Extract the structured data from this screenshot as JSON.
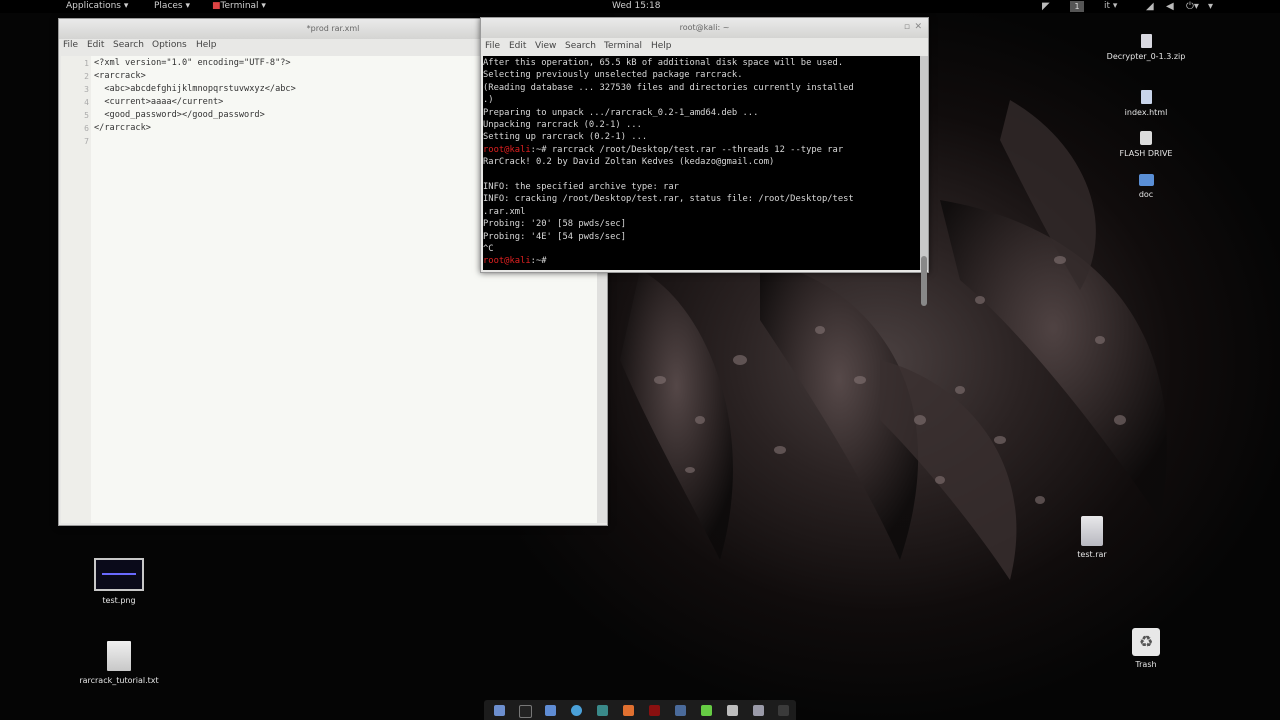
{
  "topbar": {
    "applications": "Applications ▾",
    "places": "Places ▾",
    "terminal_menu": "Terminal ▾",
    "clock": "Wed 15:18",
    "lang_box": "1",
    "lang": "it ▾"
  },
  "gedit": {
    "title": "*prod rar.xml",
    "menu": [
      "File",
      "Edit",
      "Search",
      "Options",
      "Help"
    ],
    "line_numbers": [
      "1",
      "2",
      "3",
      "4",
      "5",
      "6",
      "7"
    ],
    "lines": [
      "<?xml version=\"1.0\" encoding=\"UTF-8\"?>",
      "<rarcrack>",
      "  <abc>abcdefghijklmnopqrstuvwxyz</abc>",
      "  <current>aaaa</current>",
      "  <good_password></good_password>",
      "</rarcrack>",
      ""
    ]
  },
  "terminal": {
    "title": "root@kali: ~",
    "menu": [
      "File",
      "Edit",
      "View",
      "Search",
      "Terminal",
      "Help"
    ],
    "lines": [
      {
        "prompt": "",
        "text": "After this operation, 65.5 kB of additional disk space will be used."
      },
      {
        "prompt": "",
        "text": "Selecting previously unselected package rarcrack."
      },
      {
        "prompt": "",
        "text": "(Reading database ... 327530 files and directories currently installed"
      },
      {
        "prompt": "",
        "text": ".)"
      },
      {
        "prompt": "",
        "text": "Preparing to unpack .../rarcrack_0.2-1_amd64.deb ..."
      },
      {
        "prompt": "",
        "text": "Unpacking rarcrack (0.2-1) ..."
      },
      {
        "prompt": "",
        "text": "Setting up rarcrack (0.2-1) ..."
      },
      {
        "prompt": "root@kali",
        "text": ":~# rarcrack /root/Desktop/test.rar --threads 12 --type rar"
      },
      {
        "prompt": "",
        "text": "RarCrack! 0.2 by David Zoltan Kedves (kedazo@gmail.com)"
      },
      {
        "prompt": "",
        "text": ""
      },
      {
        "prompt": "",
        "text": "INFO: the specified archive type: rar"
      },
      {
        "prompt": "",
        "text": "INFO: cracking /root/Desktop/test.rar, status file: /root/Desktop/test"
      },
      {
        "prompt": "",
        "text": ".rar.xml"
      },
      {
        "prompt": "",
        "text": "Probing: '20' [58 pwds/sec]"
      },
      {
        "prompt": "",
        "text": "Probing: '4E' [54 pwds/sec]"
      },
      {
        "prompt": "",
        "text": "^C"
      },
      {
        "prompt": "root@kali",
        "text": ":~#"
      }
    ]
  },
  "desktop_icons": {
    "decrypter": "Decrypter_0-1.3.zip",
    "index": "index.html",
    "flash": "FLASH DRIVE",
    "doc": "doc",
    "testrar": "test.rar",
    "testpng": "test.png",
    "tutorial": "rarcrack_tutorial.txt",
    "trash": "Trash"
  },
  "dock": {
    "items": [
      "files-icon",
      "terminal-icon",
      "folder-icon",
      "browser-icon",
      "app-icon",
      "burp-icon",
      "red-icon",
      "monitor-icon",
      "green-icon",
      "gray-icon",
      "gray2-icon",
      "grid-icon"
    ]
  }
}
